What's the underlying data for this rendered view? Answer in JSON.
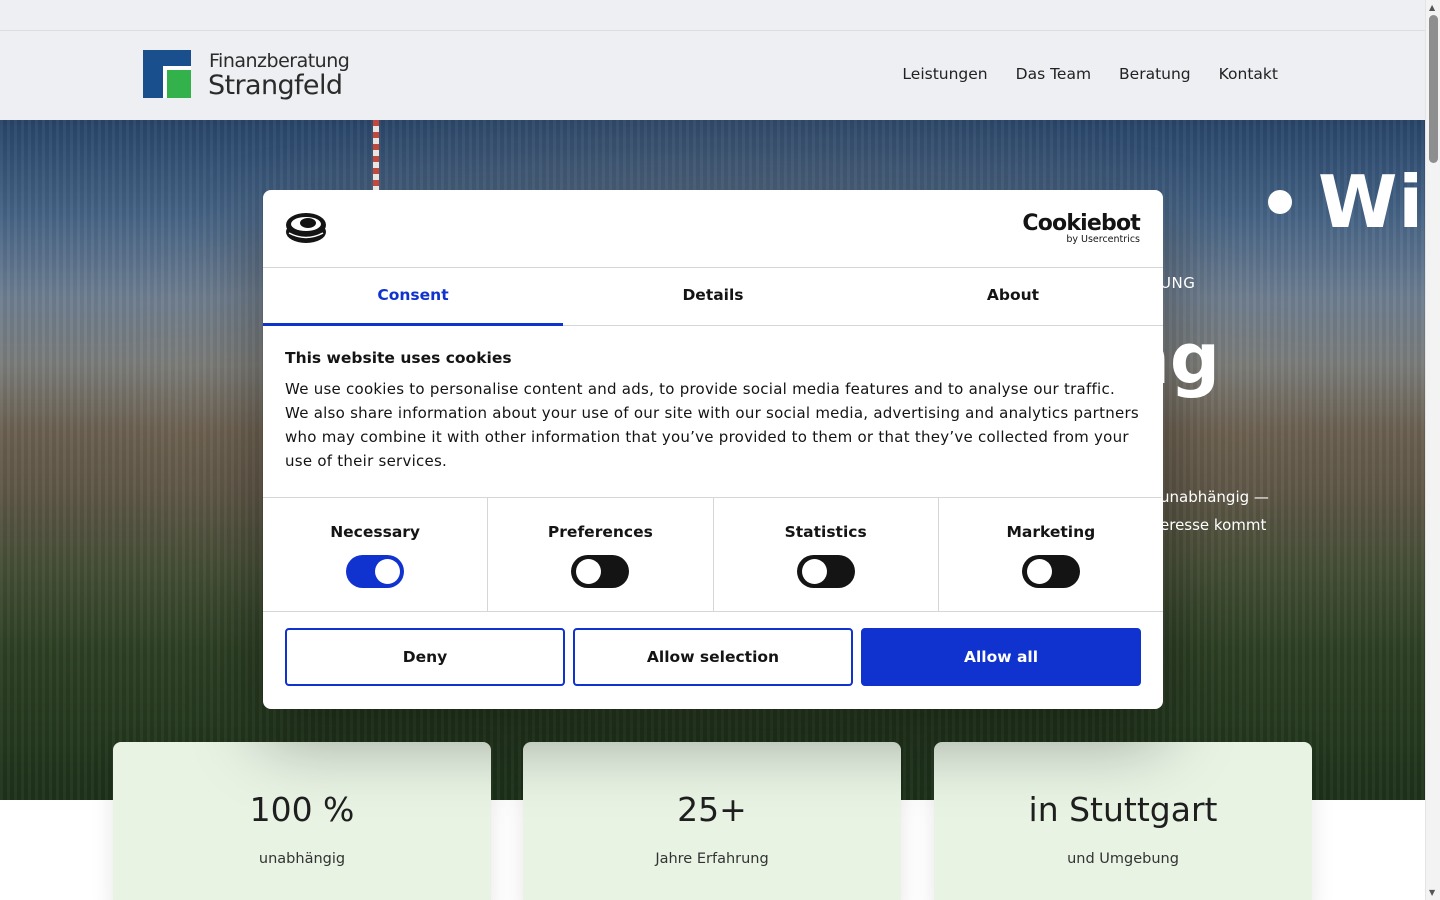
{
  "brand": {
    "line1": "Finanzberatung",
    "line2": "Strangfeld"
  },
  "nav": {
    "items": [
      "Leistungen",
      "Das Team",
      "Beratung",
      "Kontakt"
    ]
  },
  "hero": {
    "marquee": "Wir",
    "subtitle": "UNG",
    "big": "ng",
    "p1": "unabhängig —",
    "p2": "eresse kommt"
  },
  "stats": [
    {
      "value": "100 %",
      "label": "unabhängig"
    },
    {
      "value": "25+",
      "label": "Jahre Erfahrung"
    },
    {
      "value": "in Stuttgart",
      "label": "und Umgebung"
    }
  ],
  "cookie": {
    "brand": "Cookiebot",
    "brand_sub": "by Usercentrics",
    "tabs": [
      "Consent",
      "Details",
      "About"
    ],
    "active_tab": "Consent",
    "heading": "This website uses cookies",
    "text": "We use cookies to personalise content and ads, to provide social media features and to analyse our traffic. We also share information about your use of our site with our social media, advertising and analytics partners who may combine it with other information that you’ve provided to them or that they’ve collected from your use of their services.",
    "toggles": [
      {
        "label": "Necessary",
        "on": true
      },
      {
        "label": "Preferences",
        "on": false
      },
      {
        "label": "Statistics",
        "on": false
      },
      {
        "label": "Marketing",
        "on": false
      }
    ],
    "buttons": {
      "deny": "Deny",
      "allow_selection": "Allow selection",
      "allow_all": "Allow all"
    },
    "accent": "#1032cf"
  },
  "colors": {
    "brand_blue": "#1a4f8e",
    "brand_green": "#33b24b",
    "card_bg": "#e8f3e4"
  }
}
